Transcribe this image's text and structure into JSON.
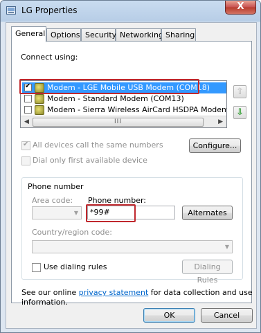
{
  "window": {
    "title": "LG Properties",
    "close_glyph": "X"
  },
  "tabs": [
    {
      "label": "General",
      "active": true
    },
    {
      "label": "Options"
    },
    {
      "label": "Security"
    },
    {
      "label": "Networking"
    },
    {
      "label": "Sharing"
    }
  ],
  "general": {
    "connect_using_label": "Connect using:",
    "modems": [
      {
        "name": "Modem - LGE Mobile USB Modem (COM18)",
        "checked": true,
        "selected": true
      },
      {
        "name": "Modem - Standard Modem (COM13)",
        "checked": false
      },
      {
        "name": "Modem - Sierra Wireless AirCard HSDPA Modem (CO",
        "checked": false
      }
    ],
    "scroll_thumb_glyph": "III",
    "all_devices_label": "All devices call the same numbers",
    "configure_label": "Configure...",
    "dial_first_label": "Dial only first available device",
    "phone_number_group": {
      "title": "Phone number",
      "area_code_label": "Area code:",
      "area_code_value": "",
      "phone_number_label": "Phone number:",
      "phone_number_value": "*99#",
      "alternates_label": "Alternates",
      "country_label": "Country/region code:",
      "country_value": "",
      "use_dialing_rules_label": "Use dialing rules",
      "dialing_rules_label": "Dialing Rules"
    },
    "privacy_prefix": "See our online ",
    "privacy_link": "privacy statement",
    "privacy_suffix": " for data collection and use",
    "privacy_line2": "information."
  },
  "footer": {
    "ok_label": "OK",
    "cancel_label": "Cancel"
  },
  "colors": {
    "highlight_box": "#c0282d",
    "selection": "#3399ff",
    "link": "#0066cc"
  }
}
